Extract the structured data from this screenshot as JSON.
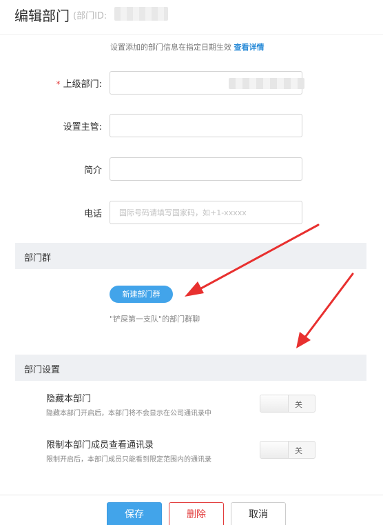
{
  "header": {
    "title": "编辑部门",
    "subtitle": "(部门ID:"
  },
  "notice": {
    "text": "设置添加的部门信息在指定日期生效",
    "link": "查看详情"
  },
  "form": {
    "parent_required_mark": "*",
    "parent_label": "上级部门:",
    "manager_label": "设置主管:",
    "intro_label": "简介",
    "phone_label": "电话",
    "phone_placeholder": "国际号码请填写国家码，如+1-xxxxx"
  },
  "group_section": {
    "title": "部门群",
    "button_label": "新建部门群",
    "description": "\"铲屎第一支队\"的部门群聊"
  },
  "settings_section": {
    "title": "部门设置",
    "items": [
      {
        "title": "隐藏本部门",
        "description": "隐藏本部门开启后，本部门将不会显示在公司通讯录中",
        "toggle_text": "关"
      },
      {
        "title": "限制本部门成员查看通讯录",
        "description": "限制开启后，本部门成员只能看到限定范围内的通讯录",
        "toggle_text": "关"
      }
    ]
  },
  "footer": {
    "save_label": "保存",
    "delete_label": "删除",
    "cancel_label": "取消"
  },
  "colors": {
    "primary": "#42a4ea",
    "danger": "#e23b3b",
    "section_bg": "#eef0f3",
    "arrow": "#e8302f"
  }
}
